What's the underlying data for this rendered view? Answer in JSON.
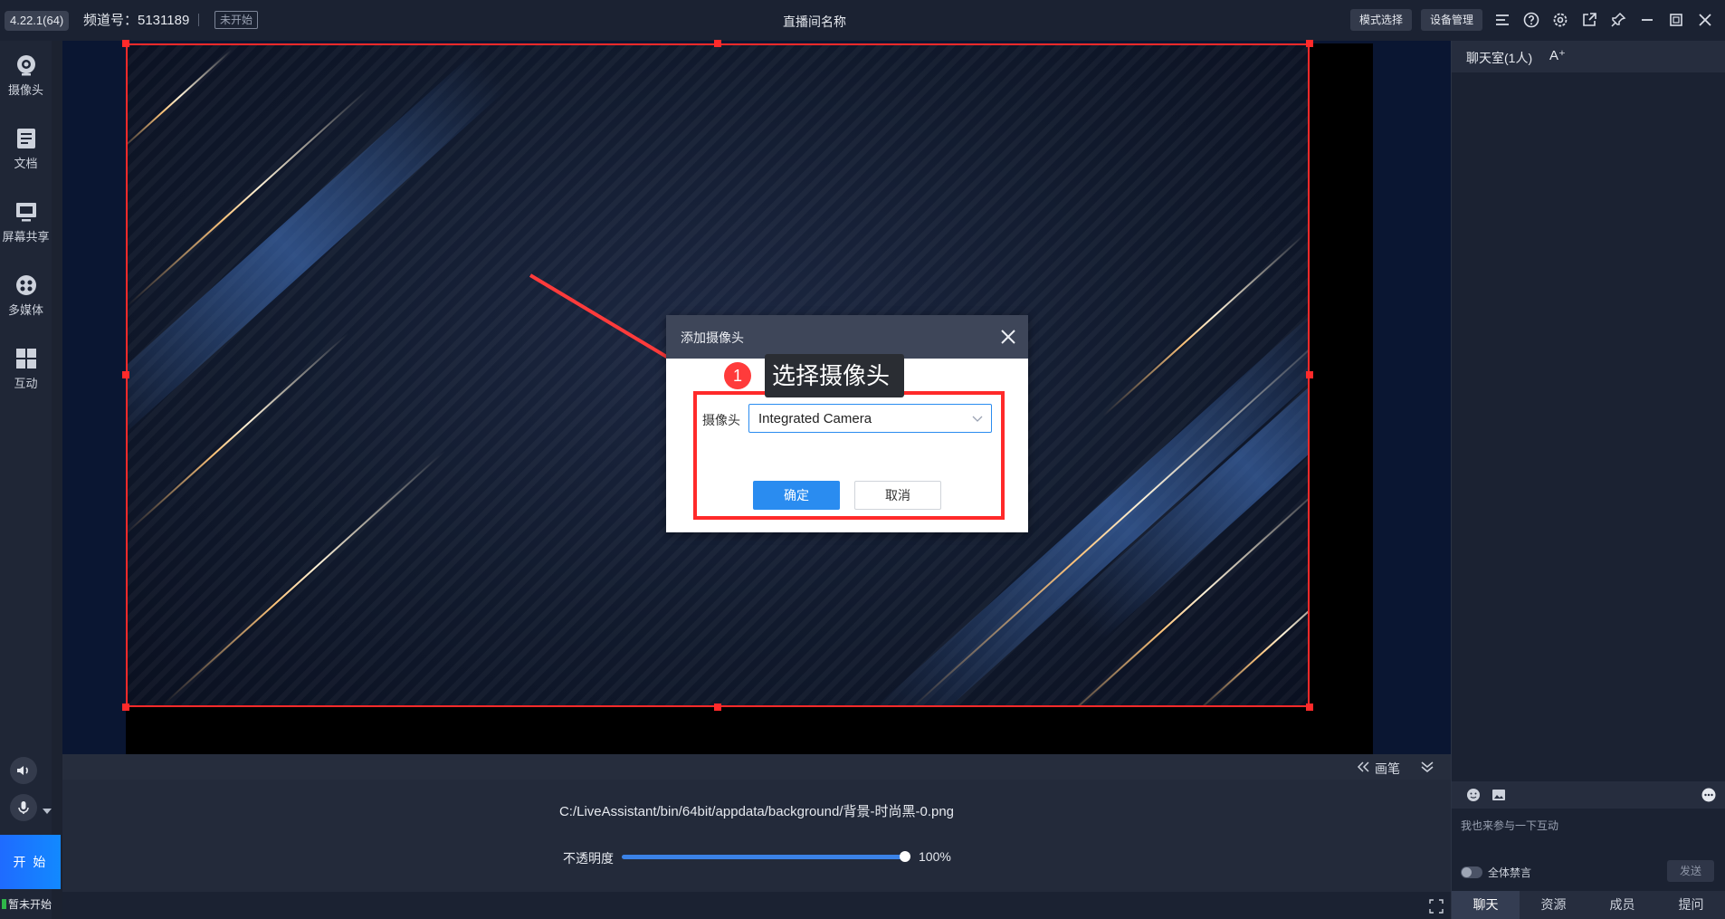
{
  "topbar": {
    "version": "4.22.1(64)",
    "channel": "频道号：5131189",
    "status_badge": "未开始",
    "room_title": "直播间名称",
    "mode_button": "模式选择",
    "device_button": "设备管理"
  },
  "sidebar": {
    "items": [
      {
        "label": "摄像头",
        "icon": "camera-icon"
      },
      {
        "label": "文档",
        "icon": "document-icon"
      },
      {
        "label": "屏幕共享",
        "icon": "screen-share-icon"
      },
      {
        "label": "多媒体",
        "icon": "multimedia-icon"
      },
      {
        "label": "互动",
        "icon": "interact-icon"
      }
    ],
    "start_label": "开 始",
    "live_status": "暂未开始"
  },
  "dialog": {
    "title": "添加摄像头",
    "field_label": "摄像头",
    "camera_value": "Integrated Camera",
    "ok_label": "确定",
    "cancel_label": "取消"
  },
  "annotation": {
    "number": "1",
    "tip": "选择摄像头",
    "accent": "#ff2a2a"
  },
  "bottom": {
    "brush_label": "画笔",
    "file_path": "C:/LiveAssistant/bin/64bit/appdata/background/背景-时尚黑-0.png",
    "opacity_label": "不透明度",
    "opacity_value": "100%"
  },
  "chat": {
    "title": "聊天室(1人)",
    "font_icon": "A⁺",
    "placeholder": "我也来参与一下互动",
    "mute_label": "全体禁言",
    "send_label": "发送",
    "tabs": [
      "聊天",
      "资源",
      "成员",
      "提问"
    ]
  }
}
